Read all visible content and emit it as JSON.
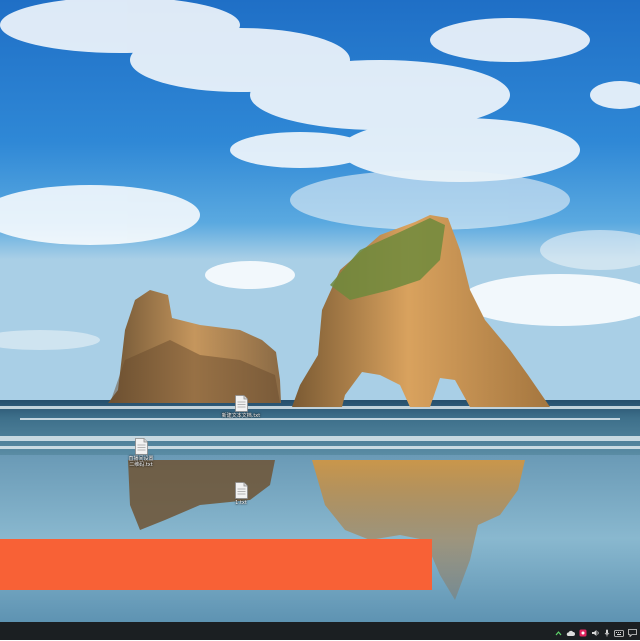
{
  "desktop": {
    "wallpaper_name": "beach-rock-arches",
    "icons": [
      {
        "name": "text-file-icon",
        "label": "新建文本文档.txt"
      },
      {
        "name": "text-file-icon",
        "label": "直播间设置\n二维码.txt"
      },
      {
        "name": "text-file-icon",
        "label": "1.txt"
      }
    ]
  },
  "overlay": {
    "color": "#f86136"
  },
  "taskbar": {
    "color": "#1b1f22",
    "tray": [
      "chevron-up-icon",
      "cloud-icon",
      "app-badge-icon",
      "volume-icon",
      "microphone-icon",
      "keyboard-icon",
      "notification-icon"
    ]
  }
}
